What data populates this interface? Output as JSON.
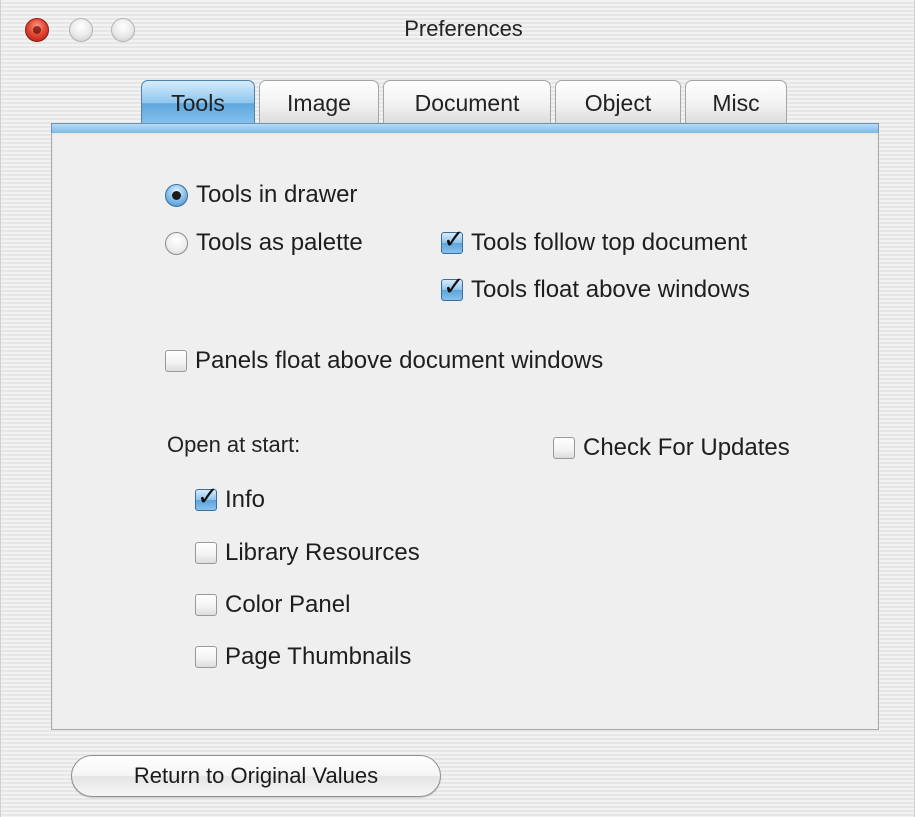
{
  "window": {
    "title": "Preferences"
  },
  "tabs": [
    {
      "label": "Tools",
      "selected": true
    },
    {
      "label": "Image",
      "selected": false
    },
    {
      "label": "Document",
      "selected": false
    },
    {
      "label": "Object",
      "selected": false
    },
    {
      "label": "Misc",
      "selected": false
    }
  ],
  "tools_panel": {
    "tools_in_drawer": {
      "label": "Tools in drawer",
      "selected": true
    },
    "tools_as_palette": {
      "label": "Tools as palette",
      "selected": false
    },
    "tools_follow_top_document": {
      "label": "Tools follow top document",
      "checked": true
    },
    "tools_float_above_windows": {
      "label": "Tools float above windows",
      "checked": true
    },
    "panels_float_above_document_windows": {
      "label": "Panels float above document windows",
      "checked": false
    },
    "open_at_start_label": "Open at start:",
    "check_for_updates": {
      "label": "Check For Updates",
      "checked": false
    },
    "open_at_start": {
      "info": {
        "label": "Info",
        "checked": true
      },
      "library_resources": {
        "label": "Library Resources",
        "checked": false
      },
      "color_panel": {
        "label": "Color Panel",
        "checked": false
      },
      "page_thumbnails": {
        "label": "Page Thumbnails",
        "checked": false
      }
    }
  },
  "footer": {
    "return_button_label": "Return to Original Values"
  },
  "colors": {
    "aqua_blue": "#5fa6dc",
    "close_red": "#e34a36"
  }
}
